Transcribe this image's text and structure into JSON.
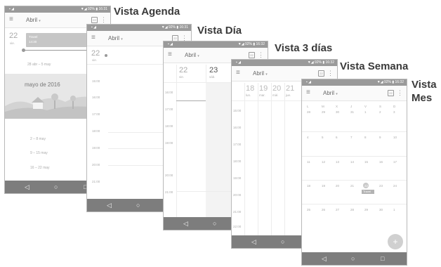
{
  "labels": {
    "agenda": "Vista Agenda",
    "day": "Vista Día",
    "three_days": "Vista 3 días",
    "week": "Vista Semana",
    "month_1": "Vista",
    "month_2": "Mes"
  },
  "status": {
    "battery": "92%",
    "time_a": "16:31",
    "time_b": "16:32"
  },
  "toolbar": {
    "month": "Abril",
    "caret": "▾",
    "menu": "≡",
    "more": "⋮",
    "cal": "22"
  },
  "navbar": {
    "back": "◁",
    "home": "○",
    "recents": "□"
  },
  "agenda": {
    "date_num": "22",
    "date_dow": "vie.",
    "event_title": "Travel",
    "event_time": "14:30",
    "item2": "28 abr – 5 may",
    "banner": "mayo de 2016",
    "week1": "2 – 8 may",
    "week2": "9 – 15 may",
    "week3": "16 – 22 may"
  },
  "day": {
    "date_num": "22",
    "date_dow": "vie.",
    "times": [
      "15:00",
      "16:00",
      "17:00",
      "18:00",
      "19:00",
      "20:00",
      "21:00"
    ]
  },
  "three": {
    "d1_num": "22",
    "d1_dow": "vie.",
    "d2_num": "23",
    "d2_dow": "sáb.",
    "times": [
      "16:00",
      "17:00",
      "18:00",
      "19:00",
      "20:00",
      "21:00"
    ]
  },
  "week": {
    "days": [
      {
        "num": "18",
        "dow": "lun."
      },
      {
        "num": "19",
        "dow": "mar."
      },
      {
        "num": "20",
        "dow": "mié."
      },
      {
        "num": "21",
        "dow": "jue."
      }
    ],
    "times": [
      "15:00",
      "16:00",
      "17:00",
      "18:00",
      "19:00",
      "20:00",
      "21:00",
      "22:00"
    ]
  },
  "month": {
    "dows": [
      "L",
      "M",
      "X",
      "J",
      "V",
      "S",
      "D"
    ],
    "rows": [
      [
        "28",
        "29",
        "30",
        "31",
        "1",
        "2",
        "3"
      ],
      [
        "4",
        "5",
        "6",
        "7",
        "8",
        "9",
        "10"
      ],
      [
        "11",
        "12",
        "13",
        "14",
        "15",
        "16",
        "17"
      ],
      [
        "18",
        "19",
        "20",
        "21",
        "22",
        "23",
        "24"
      ],
      [
        "25",
        "26",
        "27",
        "28",
        "29",
        "30",
        "1"
      ]
    ],
    "event": "Travel",
    "fab": "+"
  },
  "colors": {
    "statusbar": "#9a9a9a",
    "navbar": "#7d7d7d",
    "fab": "#d0d0d0",
    "label": "#3a3a3a"
  }
}
